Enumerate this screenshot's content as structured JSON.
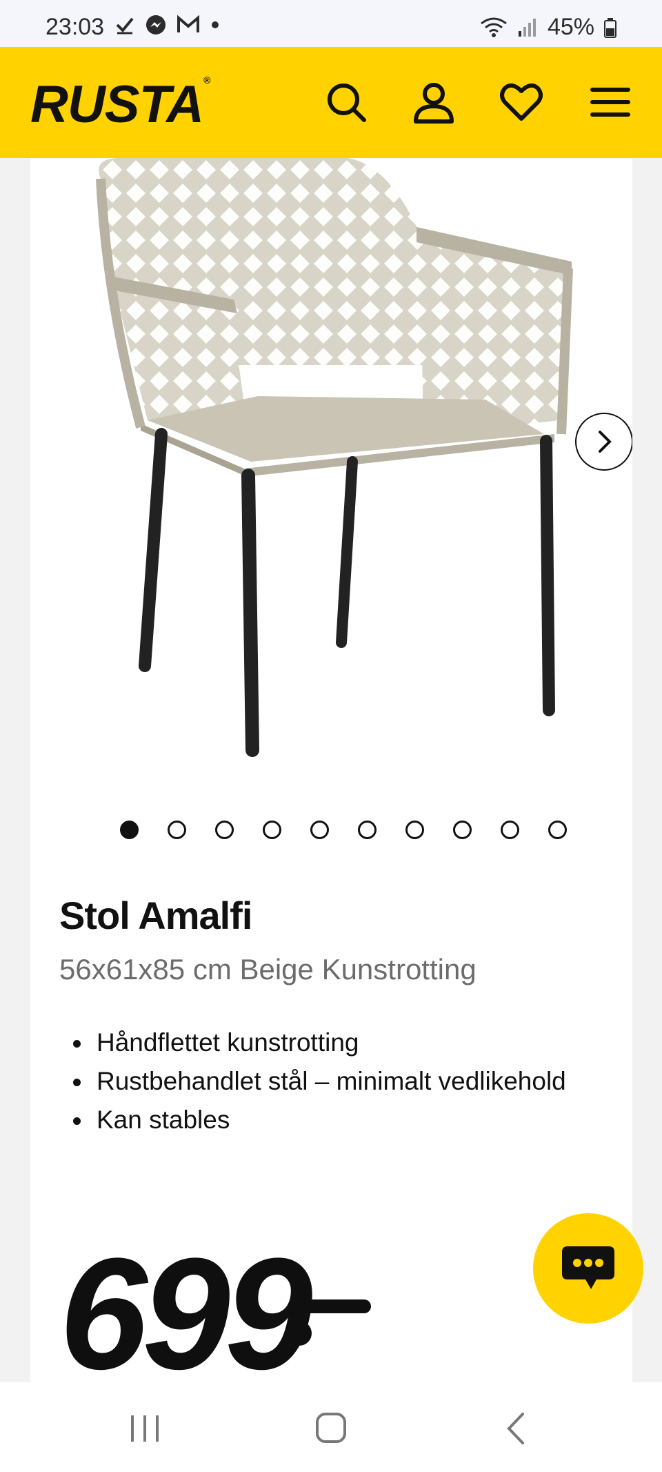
{
  "status_bar": {
    "time": "23:03",
    "battery": "45%",
    "left_icons": [
      "check-icon",
      "messenger-icon",
      "gmail-icon",
      "dot-icon"
    ],
    "right_icons": [
      "wifi-icon",
      "signal-icon",
      "battery-icon"
    ]
  },
  "header": {
    "logo": "RUSTA",
    "logo_mark": "®",
    "icons": [
      "search-icon",
      "user-icon",
      "heart-icon",
      "menu-icon"
    ]
  },
  "product": {
    "title": "Stol Amalfi",
    "subtitle": "56x61x85 cm Beige Kunstrotting",
    "features": [
      "Håndflettet kunstrotting",
      "Rustbehandlet stål – minimalt vedlikehold",
      "Kan stables"
    ],
    "price": "699",
    "image_count": 10,
    "active_image": 1
  },
  "colors": {
    "brand_yellow": "#ffd200",
    "text": "#111111",
    "muted": "#6c6c6c"
  },
  "nav_bar": {
    "icons": [
      "recent-apps-icon",
      "home-icon",
      "back-icon"
    ]
  }
}
